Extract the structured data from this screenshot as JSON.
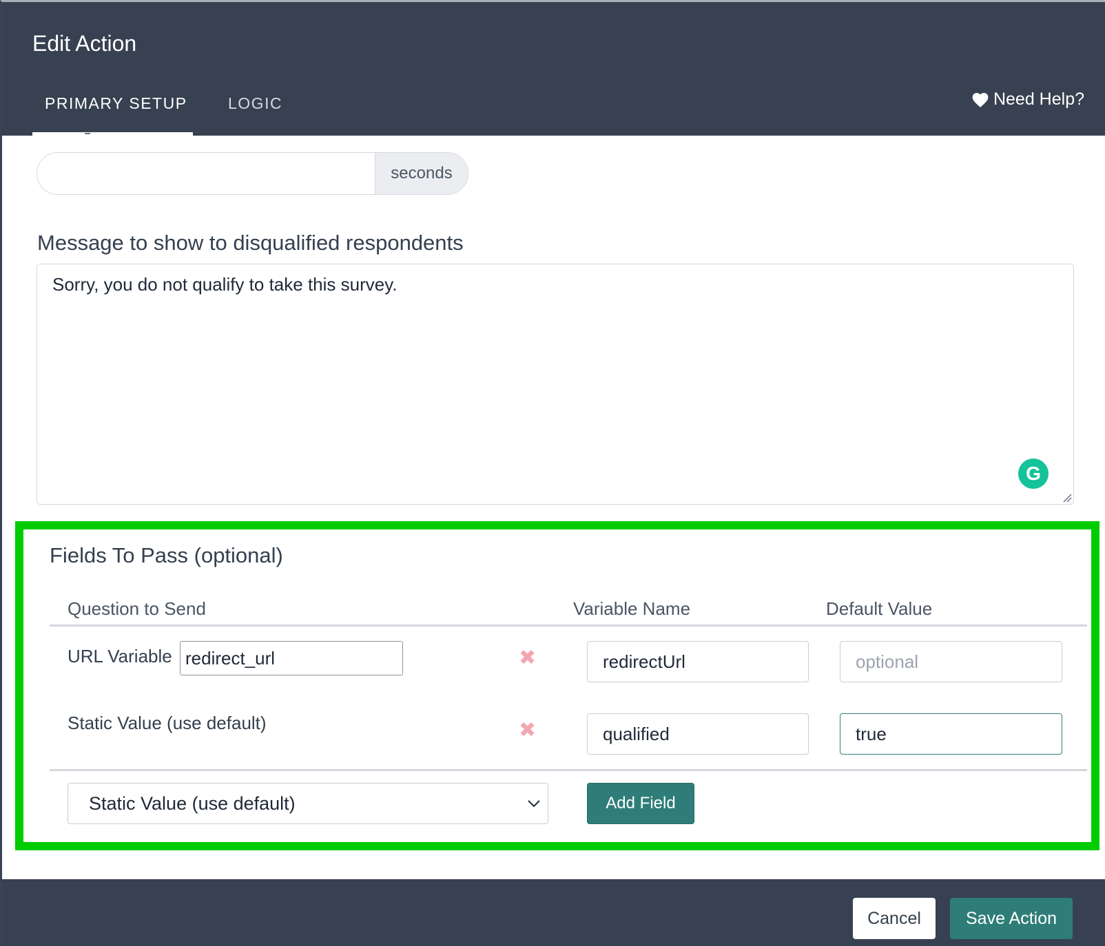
{
  "header": {
    "title": "Edit Action",
    "tabs": [
      {
        "label": "PRIMARY SETUP",
        "active": true
      },
      {
        "label": "LOGIC",
        "active": false
      }
    ],
    "help_label": "Need Help?",
    "background": "#374151"
  },
  "delay": {
    "value": "",
    "unit": "seconds"
  },
  "message": {
    "label": "Message to show to disqualified respondents",
    "value": "Sorry, you do not qualify to take this survey."
  },
  "fields": {
    "title": "Fields To Pass (optional)",
    "highlight_color": "#00cc00",
    "columns": [
      "Question to Send",
      "Variable Name",
      "Default Value"
    ],
    "rows": [
      {
        "question": "URL Variable",
        "question_input": "redirect_url",
        "variable": "redirectUrl",
        "default_value": "",
        "default_placeholder": "optional"
      },
      {
        "question": "Static Value (use default)",
        "variable": "qualified",
        "default_value": "true"
      }
    ],
    "new_field_type": "Static Value (use default)",
    "add_button": "Add Field"
  },
  "footer": {
    "cancel_label": "Cancel",
    "save_label": "Save Action",
    "accent": "#2f7d78"
  }
}
